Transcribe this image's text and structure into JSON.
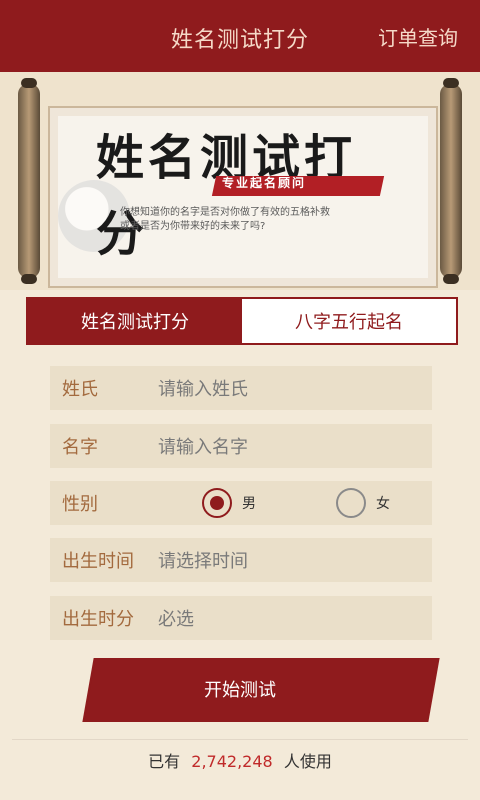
{
  "header": {
    "title": "姓名测试打分",
    "order_query": "订单查询"
  },
  "banner": {
    "calligraphy": "姓名测试打分",
    "subtitle": "专业起名顾问",
    "description_line1": "你想知道你的名字是否对你做了有效的五格补救",
    "description_line2": "或者是否为你带来好的未来了吗?"
  },
  "tabs": [
    {
      "label": "姓名测试打分"
    },
    {
      "label": "八字五行起名"
    }
  ],
  "form": {
    "surname": {
      "label": "姓氏",
      "placeholder": "请输入姓氏"
    },
    "given_name": {
      "label": "名字",
      "placeholder": "请输入名字"
    },
    "gender": {
      "label": "性别",
      "options": [
        "男",
        "女"
      ],
      "selected": "男"
    },
    "birth_time": {
      "label": "出生时间",
      "placeholder": "请选择时间"
    },
    "birth_hour": {
      "label": "出生时分",
      "placeholder": "必选"
    }
  },
  "actions": {
    "start_button": "开始测试"
  },
  "footer": {
    "prefix": "已有",
    "count": "2,742,248",
    "suffix": "人使用"
  },
  "colors": {
    "primary": "#8f1b1d",
    "accent": "#c02a2a",
    "background": "#f3ead9"
  }
}
